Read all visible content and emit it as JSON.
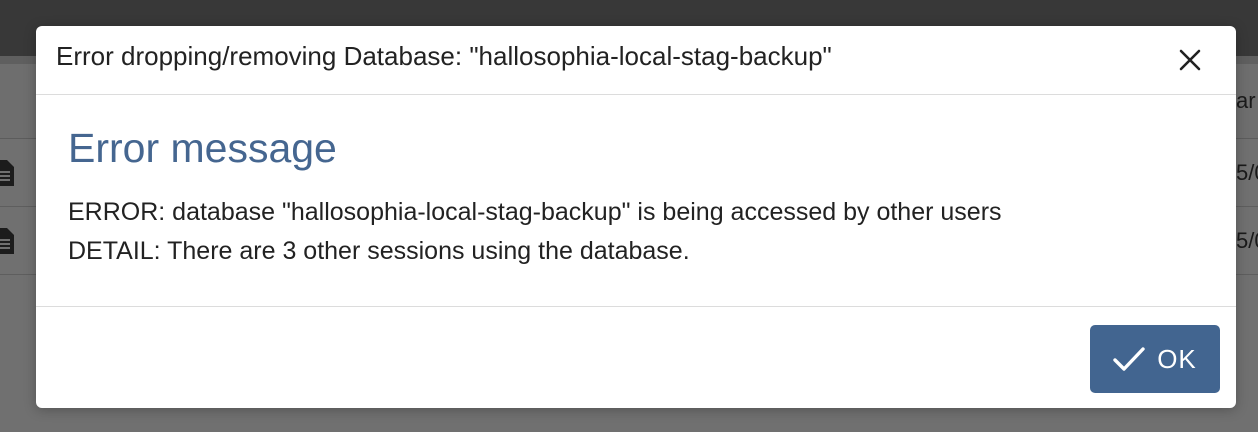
{
  "background": {
    "header_text_fragment": "ar",
    "row_text_fragments": [
      "5/0",
      "5/0"
    ]
  },
  "dialog": {
    "title": "Error dropping/removing Database: \"hallosophia-local-stag-backup\"",
    "close_icon": "close-icon",
    "heading": "Error message",
    "error_lines": [
      "ERROR: database \"hallosophia-local-stag-backup\" is being accessed by other users",
      "DETAIL: There are 3 other sessions using the database."
    ],
    "ok_button": {
      "icon": "check-icon",
      "label": "OK"
    }
  },
  "colors": {
    "accent": "#426590",
    "heading": "#456690",
    "overlay": "#707070"
  }
}
